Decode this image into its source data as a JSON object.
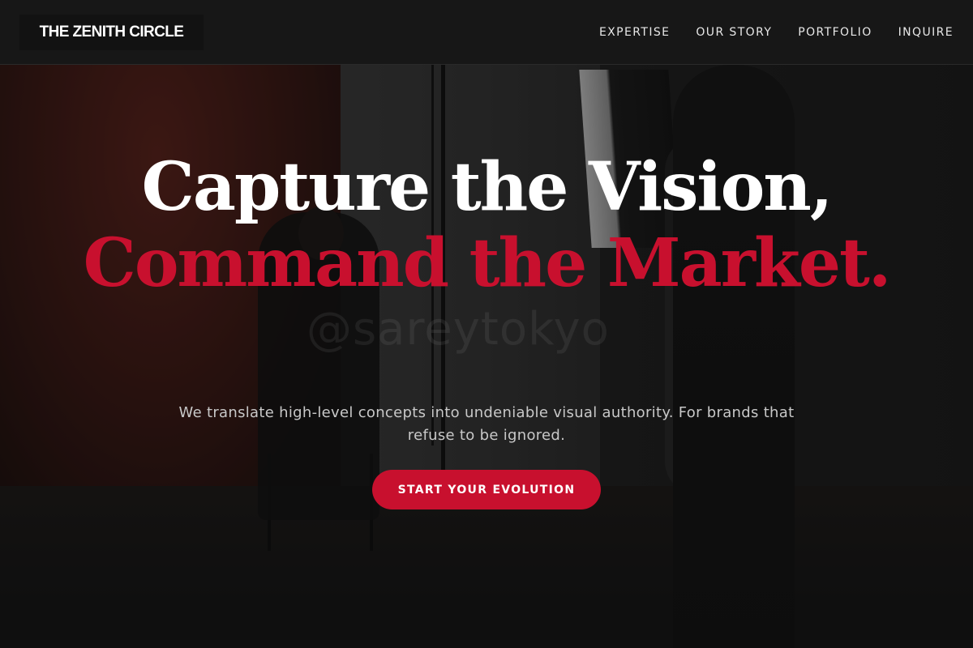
{
  "navbar": {
    "logo": "THE ZENITH CIRCLE",
    "links": [
      {
        "label": "EXPERTISE"
      },
      {
        "label": "OUR STORY"
      },
      {
        "label": "PORTFOLIO"
      },
      {
        "label": "INQUIRE"
      }
    ]
  },
  "hero": {
    "headline_line_1": "Capture the Vision,",
    "headline_accent": "Command the Market.",
    "subtext": "We translate high-level concepts into undeniable visual authority. For brands that refuse to be ignored.",
    "cta_label": "START YOUR EVOLUTION",
    "background_watermark": "@sareytokyo"
  },
  "colors": {
    "accent": "#c8102e",
    "background": "#161616",
    "navbar_background": "#171717",
    "text_primary": "#ffffff",
    "text_secondary": "#c8c8c8"
  }
}
